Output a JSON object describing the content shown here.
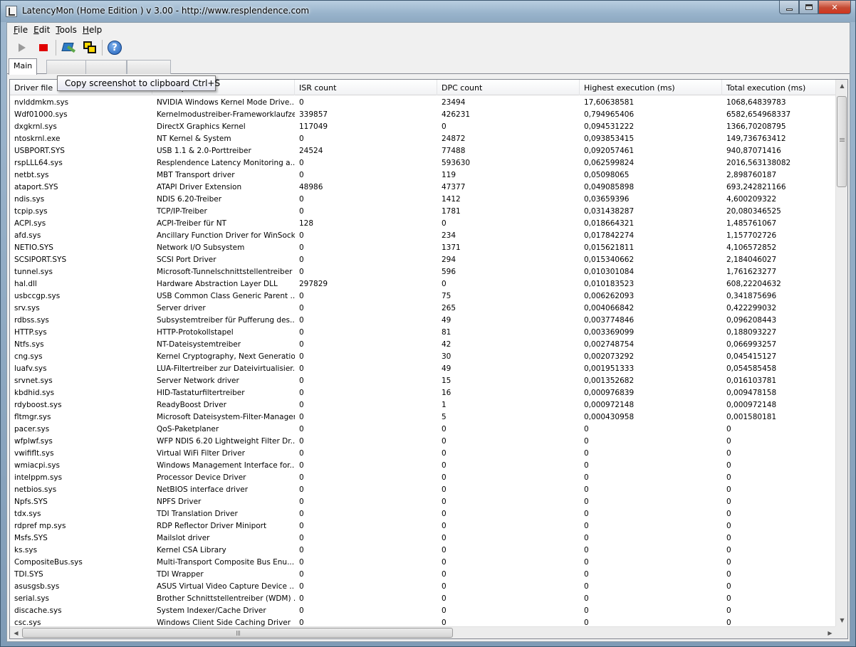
{
  "window": {
    "title": "LatencyMon  (Home Edition )  v 3.00 - http://www.resplendence.com"
  },
  "menu": [
    {
      "underline": "F",
      "rest": "ile"
    },
    {
      "underline": "E",
      "rest": "dit"
    },
    {
      "underline": "T",
      "rest": "ools"
    },
    {
      "underline": "H",
      "rest": "elp"
    }
  ],
  "toolbar": {
    "icons": [
      "play-icon",
      "stop-icon",
      "tool-icon",
      "copy-screenshot-icon",
      "help-icon"
    ],
    "help_glyph": "?"
  },
  "tooltip": "Copy screenshot to clipboard Ctrl+S",
  "tabs": {
    "active": "Main"
  },
  "table": {
    "columns": [
      "Driver file",
      "Description",
      "ISR count",
      "DPC count",
      "Highest execution (ms)",
      "Total execution (ms)"
    ],
    "rows": [
      [
        "nvlddmkm.sys",
        "NVIDIA Windows Kernel Mode Drive...",
        "0",
        "23494",
        "17,60638581",
        "1068,64839783"
      ],
      [
        "Wdf01000.sys",
        "Kernelmodustreiber-Frameworklaufzeit",
        "339857",
        "426231",
        "0,794965406",
        "6582,654968337"
      ],
      [
        "dxgkrnl.sys",
        "DirectX Graphics Kernel",
        "117049",
        "0",
        "0,094531222",
        "1366,70208795"
      ],
      [
        "ntoskrnl.exe",
        "NT Kernel & System",
        "0",
        "24872",
        "0,093853415",
        "149,736763412"
      ],
      [
        "USBPORT.SYS",
        "USB 1.1 & 2.0-Porttreiber",
        "24524",
        "77488",
        "0,092057461",
        "940,87071416"
      ],
      [
        "rspLLL64.sys",
        "Resplendence Latency Monitoring a...",
        "0",
        "593630",
        "0,062599824",
        "2016,563138082"
      ],
      [
        "netbt.sys",
        "MBT Transport driver",
        "0",
        "119",
        "0,05098065",
        "2,898760187"
      ],
      [
        "ataport.SYS",
        "ATAPI Driver Extension",
        "48986",
        "47377",
        "0,049085898",
        "693,242821166"
      ],
      [
        "ndis.sys",
        "NDIS 6.20-Treiber",
        "0",
        "1412",
        "0,03659396",
        "4,600209322"
      ],
      [
        "tcpip.sys",
        "TCP/IP-Treiber",
        "0",
        "1781",
        "0,031438287",
        "20,080346525"
      ],
      [
        "ACPI.sys",
        "ACPI-Treiber für NT",
        "128",
        "0",
        "0,018664321",
        "1,485761067"
      ],
      [
        "afd.sys",
        "Ancillary Function Driver for WinSock",
        "0",
        "234",
        "0,017842274",
        "1,157702726"
      ],
      [
        "NETIO.SYS",
        "Network I/O Subsystem",
        "0",
        "1371",
        "0,015621811",
        "4,106572852"
      ],
      [
        "SCSIPORT.SYS",
        "SCSI Port Driver",
        "0",
        "294",
        "0,015340662",
        "2,184046027"
      ],
      [
        "tunnel.sys",
        "Microsoft-Tunnelschnittstellentreiber",
        "0",
        "596",
        "0,010301084",
        "1,761623277"
      ],
      [
        "hal.dll",
        "Hardware Abstraction Layer DLL",
        "297829",
        "0",
        "0,010183523",
        "608,22204632"
      ],
      [
        "usbccgp.sys",
        "USB Common Class Generic Parent ...",
        "0",
        "75",
        "0,006262093",
        "0,341875696"
      ],
      [
        "srv.sys",
        "Server driver",
        "0",
        "265",
        "0,004066842",
        "0,422299032"
      ],
      [
        "rdbss.sys",
        "Subsystemtreiber für Pufferung des...",
        "0",
        "49",
        "0,003774846",
        "0,096208443"
      ],
      [
        "HTTP.sys",
        "HTTP-Protokollstapel",
        "0",
        "81",
        "0,003369099",
        "0,188093227"
      ],
      [
        "Ntfs.sys",
        "NT-Dateisystemtreiber",
        "0",
        "42",
        "0,002748754",
        "0,066993257"
      ],
      [
        "cng.sys",
        "Kernel Cryptography, Next Generation",
        "0",
        "30",
        "0,002073292",
        "0,045415127"
      ],
      [
        "luafv.sys",
        "LUA-Filtertreiber zur Dateivirtualisier...",
        "0",
        "49",
        "0,001951333",
        "0,054585458"
      ],
      [
        "srvnet.sys",
        "Server Network driver",
        "0",
        "15",
        "0,001352682",
        "0,016103781"
      ],
      [
        "kbdhid.sys",
        "HID-Tastaturfiltertreiber",
        "0",
        "16",
        "0,000976839",
        "0,009478158"
      ],
      [
        "rdyboost.sys",
        "ReadyBoost Driver",
        "0",
        "1",
        "0,000972148",
        "0,000972148"
      ],
      [
        "fltmgr.sys",
        "Microsoft Dateisystem-Filter-Manager",
        "0",
        "5",
        "0,000430958",
        "0,001580181"
      ],
      [
        "pacer.sys",
        "QoS-Paketplaner",
        "0",
        "0",
        "0",
        "0"
      ],
      [
        "wfplwf.sys",
        "WFP NDIS 6.20 Lightweight Filter Dr...",
        "0",
        "0",
        "0",
        "0"
      ],
      [
        "vwififlt.sys",
        "Virtual WiFi Filter Driver",
        "0",
        "0",
        "0",
        "0"
      ],
      [
        "wmiacpi.sys",
        "Windows Management Interface for...",
        "0",
        "0",
        "0",
        "0"
      ],
      [
        "intelppm.sys",
        "Processor Device Driver",
        "0",
        "0",
        "0",
        "0"
      ],
      [
        "netbios.sys",
        "NetBIOS interface driver",
        "0",
        "0",
        "0",
        "0"
      ],
      [
        "Npfs.SYS",
        "NPFS Driver",
        "0",
        "0",
        "0",
        "0"
      ],
      [
        "tdx.sys",
        "TDI Translation Driver",
        "0",
        "0",
        "0",
        "0"
      ],
      [
        "rdpref mp.sys",
        "RDP Reflector Driver Miniport",
        "0",
        "0",
        "0",
        "0"
      ],
      [
        "Msfs.SYS",
        "Mailslot driver",
        "0",
        "0",
        "0",
        "0"
      ],
      [
        "ks.sys",
        "Kernel CSA Library",
        "0",
        "0",
        "0",
        "0"
      ],
      [
        "CompositeBus.sys",
        "Multi-Transport Composite Bus Enu...",
        "0",
        "0",
        "0",
        "0"
      ],
      [
        "TDI.SYS",
        "TDI Wrapper",
        "0",
        "0",
        "0",
        "0"
      ],
      [
        "asusgsb.sys",
        "ASUS Virtual Video Capture Device ...",
        "0",
        "0",
        "0",
        "0"
      ],
      [
        "serial.sys",
        "Brother Schnittstellentreiber (WDM) ...",
        "0",
        "0",
        "0",
        "0"
      ],
      [
        "discache.sys",
        "System Indexer/Cache Driver",
        "0",
        "0",
        "0",
        "0"
      ],
      [
        "csc.sys",
        "Windows Client Side Caching Driver",
        "0",
        "0",
        "0",
        "0"
      ]
    ]
  }
}
